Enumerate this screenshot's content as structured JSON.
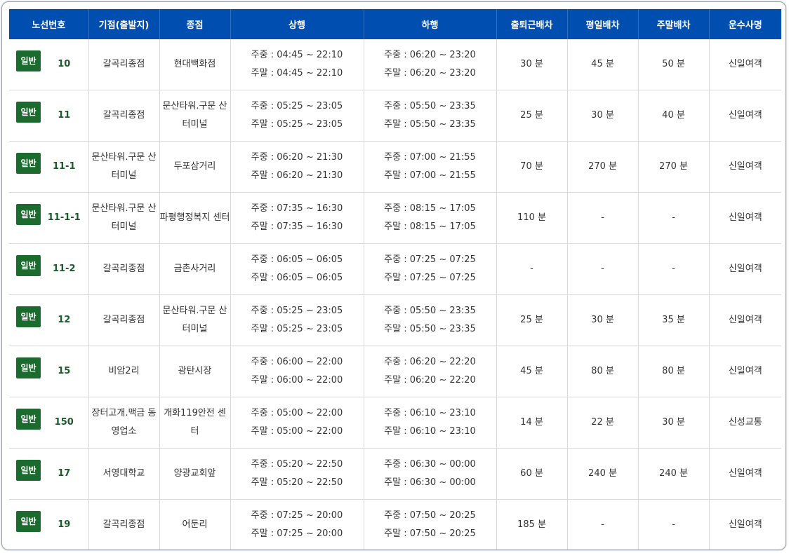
{
  "headers": [
    "노선번호",
    "기점(출발지)",
    "종점",
    "상행",
    "하행",
    "출퇴근배차",
    "평일배차",
    "주말배차",
    "운수사명"
  ],
  "rows": [
    {
      "badge": "일반",
      "route": "10",
      "start": "갈곡리종점",
      "end": "현대백화점",
      "up": [
        "주중 : 04:45 ~ 22:10",
        "주말 : 04:45 ~ 22:10"
      ],
      "down": [
        "주중 : 06:20 ~ 23:20",
        "주말 : 06:20 ~ 23:20"
      ],
      "commute": "30 분",
      "weekday": "45 분",
      "weekend": "50 분",
      "company": "신일여객"
    },
    {
      "badge": "일반",
      "route": "11",
      "start": "갈곡리종점",
      "end": "문산타워.구문 산터미널",
      "up": [
        "주중 : 05:25 ~ 23:05",
        "주말 : 05:25 ~ 23:05"
      ],
      "down": [
        "주중 : 05:50 ~ 23:35",
        "주말 : 05:50 ~ 23:35"
      ],
      "commute": "25 분",
      "weekday": "30 분",
      "weekend": "40 분",
      "company": "신일여객"
    },
    {
      "badge": "일반",
      "route": "11-1",
      "start": "문산타워.구문 산터미널",
      "end": "두포삼거리",
      "up": [
        "주중 : 06:20 ~ 21:30",
        "주말 : 06:20 ~ 21:30"
      ],
      "down": [
        "주중 : 07:00 ~ 21:55",
        "주말 : 07:00 ~ 21:55"
      ],
      "commute": "70 분",
      "weekday": "270 분",
      "weekend": "270 분",
      "company": "신일여객"
    },
    {
      "badge": "일반",
      "route": "11-1-1",
      "start": "문산타워.구문 산터미널",
      "end": "파평행정복지 센터",
      "up": [
        "주중 : 07:35 ~ 16:30",
        "주말 : 07:35 ~ 16:30"
      ],
      "down": [
        "주중 : 08:15 ~ 17:05",
        "주말 : 08:15 ~ 17:05"
      ],
      "commute": "110 분",
      "weekday": "-",
      "weekend": "-",
      "company": "신일여객"
    },
    {
      "badge": "일반",
      "route": "11-2",
      "start": "갈곡리종점",
      "end": "금촌사거리",
      "up": [
        "주중 : 06:05 ~ 06:05",
        "주말 : 06:05 ~ 06:05"
      ],
      "down": [
        "주중 : 07:25 ~ 07:25",
        "주말 : 07:25 ~ 07:25"
      ],
      "commute": "-",
      "weekday": "-",
      "weekend": "-",
      "company": "신일여객"
    },
    {
      "badge": "일반",
      "route": "12",
      "start": "갈곡리종점",
      "end": "문산타워.구문 산터미널",
      "up": [
        "주중 : 05:25 ~ 23:05",
        "주말 : 05:25 ~ 23:05"
      ],
      "down": [
        "주중 : 05:50 ~ 23:35",
        "주말 : 05:50 ~ 23:35"
      ],
      "commute": "25 분",
      "weekday": "30 분",
      "weekend": "35 분",
      "company": "신일여객"
    },
    {
      "badge": "일반",
      "route": "15",
      "start": "비암2리",
      "end": "광탄시장",
      "up": [
        "주중 : 06:00 ~ 22:00",
        "주말 : 06:00 ~ 22:00"
      ],
      "down": [
        "주중 : 06:20 ~ 22:20",
        "주말 : 06:20 ~ 22:20"
      ],
      "commute": "45 분",
      "weekday": "80 분",
      "weekend": "80 분",
      "company": "신일여객"
    },
    {
      "badge": "일반",
      "route": "150",
      "start": "장터고개.맥금 동영업소",
      "end": "개화119안전 센터",
      "up": [
        "주중 : 05:00 ~ 22:00",
        "주말 : 05:00 ~ 22:00"
      ],
      "down": [
        "주중 : 06:10 ~ 23:10",
        "주말 : 06:10 ~ 23:10"
      ],
      "commute": "14 분",
      "weekday": "22 분",
      "weekend": "30 분",
      "company": "신성교통"
    },
    {
      "badge": "일반",
      "route": "17",
      "start": "서영대학교",
      "end": "양광교회앞",
      "up": [
        "주중 : 05:20 ~ 22:50",
        "주말 : 05:20 ~ 22:50"
      ],
      "down": [
        "주중 : 06:30 ~ 00:00",
        "주말 : 06:30 ~ 00:00"
      ],
      "commute": "60 분",
      "weekday": "240 분",
      "weekend": "240 분",
      "company": "신일여객"
    },
    {
      "badge": "일반",
      "route": "19",
      "start": "갈곡리종점",
      "end": "어둔리",
      "up": [
        "주중 : 07:25 ~ 20:00",
        "주말 : 07:25 ~ 20:00"
      ],
      "down": [
        "주중 : 07:50 ~ 20:25",
        "주말 : 07:50 ~ 20:25"
      ],
      "commute": "185 분",
      "weekday": "-",
      "weekend": "-",
      "company": "신일여객"
    }
  ]
}
